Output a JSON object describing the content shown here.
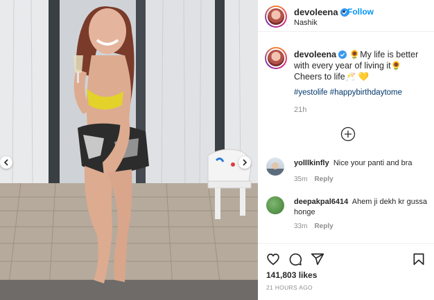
{
  "post": {
    "username": "devoleena",
    "follow_label": "Follow",
    "separator": "•",
    "location": "Nashik",
    "caption_line1": "🌻My life is better with every year of living it🌻",
    "caption_line2": "Cheers to life🥂 💛",
    "hashtags": [
      "#yestolife",
      "#happybirthdaytome"
    ],
    "caption_time": "21h",
    "likes": "141,803 likes",
    "posted": "21 HOURS AGO"
  },
  "comments": [
    {
      "username": "yolllkinfly",
      "text": "Nice your panti and bra",
      "time": "35m",
      "reply_label": "Reply"
    },
    {
      "username": "deepakpal6414",
      "text": "Ahem ji dekh kr gussa honge",
      "time": "33m",
      "reply_label": "Reply"
    }
  ],
  "icons": {
    "verified": "verified-badge-icon",
    "load_more": "plus-circle-icon",
    "like": "heart-icon",
    "comment": "comment-icon",
    "share": "paper-plane-icon",
    "save": "bookmark-icon",
    "prev": "chevron-left-icon",
    "next": "chevron-right-icon"
  },
  "colors": {
    "accent": "#0095f6",
    "verified": "#3897f0",
    "muted": "#8e8e8e",
    "hashtag": "#00376b"
  }
}
